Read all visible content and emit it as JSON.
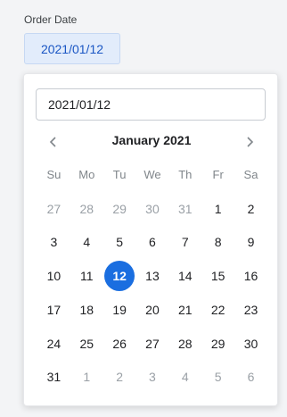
{
  "field": {
    "label": "Order Date",
    "value": "2021/01/12"
  },
  "popover": {
    "input_value": "2021/01/12",
    "month_title": "January 2021",
    "prev_icon": "chevron-left-icon",
    "next_icon": "chevron-right-icon",
    "weekdays": [
      "Su",
      "Mo",
      "Tu",
      "We",
      "Th",
      "Fr",
      "Sa"
    ],
    "weeks": [
      [
        {
          "d": "27",
          "m": true
        },
        {
          "d": "28",
          "m": true
        },
        {
          "d": "29",
          "m": true
        },
        {
          "d": "30",
          "m": true
        },
        {
          "d": "31",
          "m": true
        },
        {
          "d": "1",
          "m": false
        },
        {
          "d": "2",
          "m": false
        }
      ],
      [
        {
          "d": "3",
          "m": false
        },
        {
          "d": "4",
          "m": false
        },
        {
          "d": "5",
          "m": false
        },
        {
          "d": "6",
          "m": false
        },
        {
          "d": "7",
          "m": false
        },
        {
          "d": "8",
          "m": false
        },
        {
          "d": "9",
          "m": false
        }
      ],
      [
        {
          "d": "10",
          "m": false
        },
        {
          "d": "11",
          "m": false
        },
        {
          "d": "12",
          "m": false,
          "selected": true
        },
        {
          "d": "13",
          "m": false
        },
        {
          "d": "14",
          "m": false
        },
        {
          "d": "15",
          "m": false
        },
        {
          "d": "16",
          "m": false
        }
      ],
      [
        {
          "d": "17",
          "m": false
        },
        {
          "d": "18",
          "m": false
        },
        {
          "d": "19",
          "m": false
        },
        {
          "d": "20",
          "m": false
        },
        {
          "d": "21",
          "m": false
        },
        {
          "d": "22",
          "m": false
        },
        {
          "d": "23",
          "m": false
        }
      ],
      [
        {
          "d": "24",
          "m": false
        },
        {
          "d": "25",
          "m": false
        },
        {
          "d": "26",
          "m": false
        },
        {
          "d": "27",
          "m": false
        },
        {
          "d": "28",
          "m": false
        },
        {
          "d": "29",
          "m": false
        },
        {
          "d": "30",
          "m": false
        }
      ],
      [
        {
          "d": "31",
          "m": false
        },
        {
          "d": "1",
          "m": true
        },
        {
          "d": "2",
          "m": true
        },
        {
          "d": "3",
          "m": true
        },
        {
          "d": "4",
          "m": true
        },
        {
          "d": "5",
          "m": true
        },
        {
          "d": "6",
          "m": true
        }
      ]
    ]
  },
  "colors": {
    "accent": "#1a6ee0",
    "field_bg": "#e2ecfb",
    "muted_text": "#9aa0a6"
  }
}
